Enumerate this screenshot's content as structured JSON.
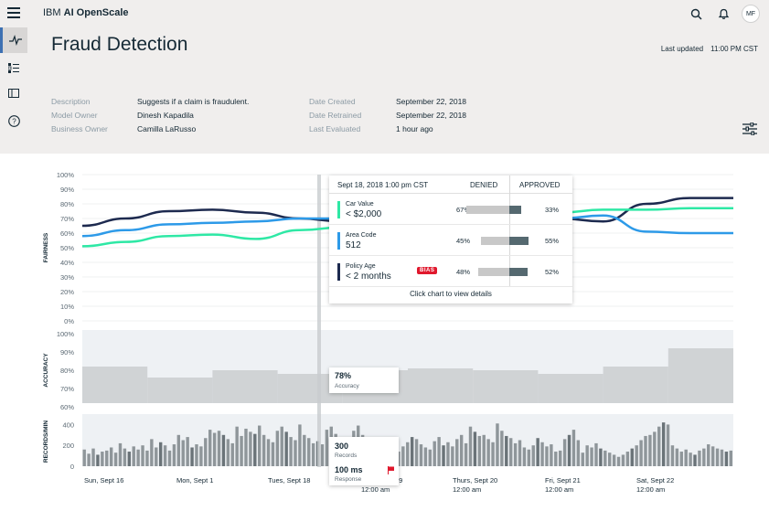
{
  "app": {
    "brand_prefix": "IBM",
    "brand_name": "AI OpenScale"
  },
  "user": {
    "initials": "MF"
  },
  "page": {
    "title": "Fraud Detection",
    "last_updated_label": "Last updated",
    "last_updated_value": "11:00 PM CST"
  },
  "meta_left": [
    {
      "label": "Description",
      "value": "Suggests if a claim is fraudulent."
    },
    {
      "label": "Model Owner",
      "value": "Dinesh Kapadila"
    },
    {
      "label": "Business Owner",
      "value": "Camilla LaRusso"
    }
  ],
  "meta_right": [
    {
      "label": "Date Created",
      "value": "September 22, 2018"
    },
    {
      "label": "Date Retrained",
      "value": "September 22, 2018"
    },
    {
      "label": "Last Evaluated",
      "value": "1 hour ago"
    }
  ],
  "colors": {
    "teal": "#2ee8a5",
    "blue": "#2d9ae8",
    "navy": "#1d2a4f",
    "accent": "#3d70b2",
    "bias": "#e0182d"
  },
  "chart_data": [
    {
      "type": "line",
      "ylabel": "FAIRNESS",
      "ylim": [
        0,
        100
      ],
      "y_ticks": [
        "100%",
        "90%",
        "80%",
        "70%",
        "60%",
        "50%",
        "40%",
        "30%",
        "20%",
        "10%",
        "0%"
      ],
      "x_positions": [
        0,
        1,
        2,
        3,
        4,
        5,
        6,
        7,
        8,
        9,
        10,
        11,
        12,
        13,
        14
      ],
      "series": [
        {
          "color": "#1d2a4f",
          "values": [
            65,
            70,
            75,
            76,
            74,
            70,
            68,
            70,
            72,
            76,
            74,
            70,
            68,
            80,
            84,
            84
          ]
        },
        {
          "color": "#2d9ae8",
          "values": [
            58,
            62,
            66,
            67,
            68,
            70,
            70,
            66,
            65,
            65,
            66,
            70,
            72,
            61,
            60,
            60
          ]
        },
        {
          "color": "#2ee8a5",
          "values": [
            51,
            54,
            58,
            59,
            56,
            62,
            64,
            66,
            66,
            68,
            70,
            74,
            76,
            76,
            77,
            77
          ]
        }
      ]
    },
    {
      "type": "area",
      "ylabel": "ACCURACY",
      "ylim": [
        60,
        100
      ],
      "y_ticks": [
        "100%",
        "90%",
        "80%",
        "70%",
        "60%"
      ],
      "segments": [
        80,
        74,
        78,
        76,
        78,
        79,
        78,
        76,
        80,
        90
      ]
    },
    {
      "type": "bar",
      "ylabel": "RECORDS/MIN",
      "ylim": [
        0,
        500
      ],
      "y_ticks": [
        "400",
        "200",
        "0"
      ],
      "x_tick_labels": [
        {
          "line1": "Sun, Sept 16",
          "line2": ""
        },
        {
          "line1": "Mon, Sept 1",
          "line2": ""
        },
        {
          "line1": "Tues, Sept 18",
          "line2": ""
        },
        {
          "line1": "Wed, Sept 19",
          "line2": "12:00 am"
        },
        {
          "line1": "Thurs, Sept 20",
          "line2": "12:00 am"
        },
        {
          "line1": "Fri, Sept 21",
          "line2": "12:00 am"
        },
        {
          "line1": "Sat, Sept 22",
          "line2": "12:00 am"
        }
      ],
      "values": [
        160,
        120,
        170,
        110,
        140,
        150,
        180,
        130,
        220,
        170,
        140,
        190,
        160,
        200,
        150,
        260,
        180,
        230,
        200,
        150,
        210,
        300,
        250,
        280,
        180,
        210,
        190,
        270,
        350,
        320,
        340,
        300,
        260,
        220,
        380,
        290,
        360,
        330,
        310,
        390,
        300,
        260,
        230,
        340,
        380,
        330,
        280,
        250,
        400,
        300,
        270,
        220,
        240,
        210,
        350,
        380,
        310,
        280,
        220,
        200,
        340,
        390,
        300,
        230,
        210,
        150,
        180,
        250,
        280,
        220,
        140,
        190,
        230,
        280,
        260,
        210,
        180,
        160,
        240,
        280,
        200,
        230,
        190,
        260,
        300,
        220,
        380,
        330,
        290,
        300,
        260,
        230,
        410,
        340,
        290,
        270,
        220,
        250,
        180,
        160,
        200,
        270,
        230,
        190,
        210,
        140,
        150,
        260,
        300,
        350,
        250,
        130,
        200,
        180,
        220,
        170,
        150,
        130,
        110,
        90,
        110,
        140,
        170,
        200,
        250,
        290,
        300,
        330,
        380,
        420,
        400,
        200,
        170,
        140,
        160,
        130,
        110,
        150,
        170,
        210,
        190,
        170,
        160,
        140,
        150
      ]
    }
  ],
  "tooltip": {
    "date": "Sept 18, 2018 1:00 pm CST",
    "denied_label": "DENIED",
    "approved_label": "APPROVED",
    "rows": [
      {
        "attr": "Car Value",
        "group": "< $2,000",
        "denied": "67%",
        "approved": "33%",
        "denied_frac": 0.67,
        "approved_frac": 0.33,
        "color": "#2ee8a5",
        "bias": ""
      },
      {
        "attr": "Area Code",
        "group": "512",
        "denied": "45%",
        "approved": "55%",
        "denied_frac": 0.45,
        "approved_frac": 0.55,
        "color": "#2d9ae8",
        "bias": ""
      },
      {
        "attr": "Policy Age",
        "group": "< 2 months",
        "denied": "48%",
        "approved": "52%",
        "denied_frac": 0.48,
        "approved_frac": 0.52,
        "color": "#1d2a4f",
        "bias": "BIAS"
      }
    ],
    "footer": "Click chart to view details"
  },
  "accuracy_box": {
    "value": "78%",
    "label": "Accuracy"
  },
  "records_box": {
    "value": "300",
    "label": "Records",
    "response_value": "100 ms",
    "response_label": "Response"
  }
}
